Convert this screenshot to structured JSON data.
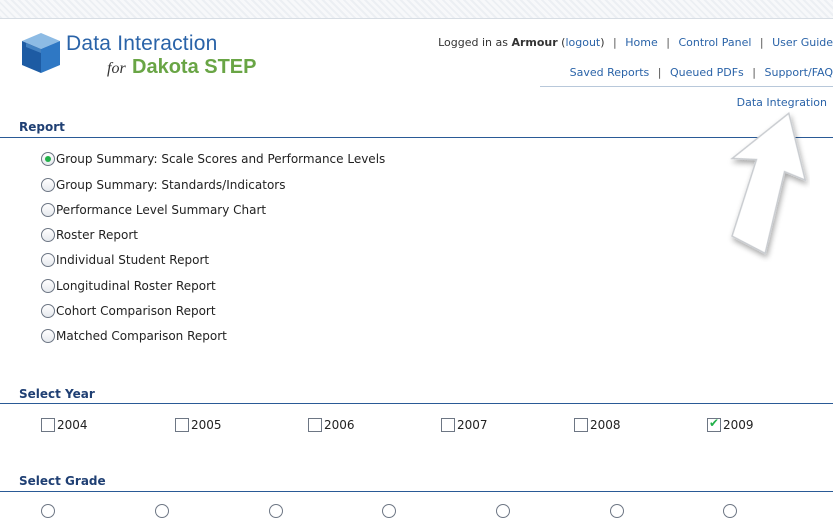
{
  "header": {
    "logo_title": "Data Interaction",
    "logo_for": "for",
    "logo_brand": "Dakota STEP",
    "logged_in_prefix": "Logged in as",
    "user_name": "Armour",
    "logout_open": "(",
    "logout_label": "logout",
    "logout_close": ")",
    "sep": "|",
    "nav": [
      "Home",
      "Control Panel",
      "User Guide"
    ],
    "nav2": [
      "Saved Reports",
      "Queued PDFs",
      "Support/FAQ"
    ],
    "nav3": "Data Integration"
  },
  "report": {
    "title": "Report",
    "options": [
      {
        "label": "Group Summary: Scale Scores and Performance Levels",
        "checked": true
      },
      {
        "label": "Group Summary: Standards/Indicators",
        "checked": false
      },
      {
        "label": "Performance Level Summary Chart",
        "checked": false
      },
      {
        "label": "Roster Report",
        "checked": false
      },
      {
        "label": "Individual Student Report",
        "checked": false
      },
      {
        "label": "Longitudinal Roster Report",
        "checked": false
      },
      {
        "label": "Cohort Comparison Report",
        "checked": false
      },
      {
        "label": "Matched Comparison Report",
        "checked": false
      }
    ]
  },
  "year": {
    "title": "Select Year",
    "options": [
      {
        "label": "2004",
        "checked": false
      },
      {
        "label": "2005",
        "checked": false
      },
      {
        "label": "2006",
        "checked": false
      },
      {
        "label": "2007",
        "checked": false
      },
      {
        "label": "2008",
        "checked": false
      },
      {
        "label": "2009",
        "checked": true
      }
    ]
  },
  "grade": {
    "title": "Select Grade"
  },
  "colors": {
    "brand_blue": "#2a63a8",
    "brand_green": "#69a545",
    "section_blue": "#1f3f73",
    "check_green": "#22b04a"
  }
}
